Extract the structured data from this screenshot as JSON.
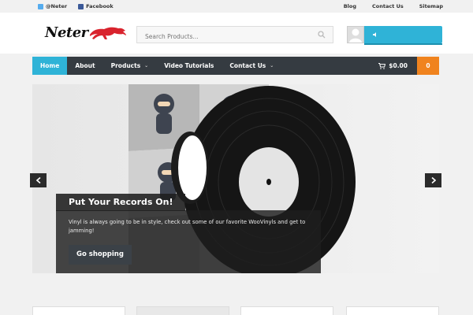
{
  "topbar": {
    "twitter_label": "@Neter",
    "facebook_label": "Facebook",
    "links": [
      "Blog",
      "Contact Us",
      "Sitemap"
    ]
  },
  "header": {
    "logo_text": "Neter",
    "search_placeholder": "Search Products..."
  },
  "nav": {
    "items": [
      {
        "label": "Home"
      },
      {
        "label": "About"
      },
      {
        "label": "Products"
      },
      {
        "label": "Video Tutorials"
      },
      {
        "label": "Contact Us"
      }
    ],
    "cart_total": "$0.00",
    "cart_count": "0"
  },
  "slider": {
    "title": "Put Your Records On!",
    "text": "Vinyl is always going to be in style, check out some of our favorite WooVinyls and get to jamming!",
    "button_label": "Go shopping"
  },
  "colors": {
    "accent": "#2fb3d7",
    "nav_bg": "#353b41",
    "cart_badge": "#f0831e"
  }
}
